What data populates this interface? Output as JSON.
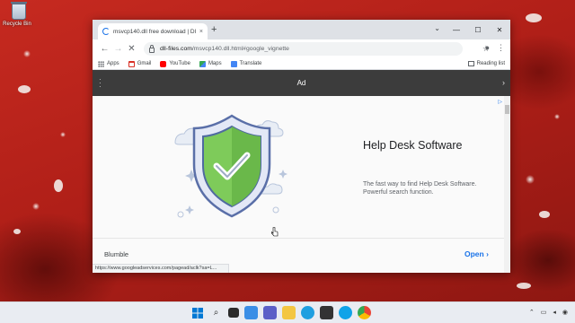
{
  "desktop": {
    "icon_label": "Recycle Bin"
  },
  "browser": {
    "tab_title": "msvcp140.dll free download | Dl",
    "tab_close": "×",
    "new_tab": "+",
    "window_controls": {
      "minimize": "—",
      "maximize": "☐",
      "close": "✕"
    },
    "url_host": "dll-files.com",
    "url_rest": "/msvcp140.dll.html#google_vignette",
    "bookmarks": [
      {
        "label": "Apps",
        "icon": "apps-icon"
      },
      {
        "label": "Gmail",
        "icon": "gmail-icon"
      },
      {
        "label": "YouTube",
        "icon": "youtube-icon"
      },
      {
        "label": "Maps",
        "icon": "maps-icon"
      },
      {
        "label": "Translate",
        "icon": "translate-icon"
      }
    ],
    "reading_list": "Reading list",
    "status_url": "https://www.googleadservices.com/pagead/aclk?sa=L..."
  },
  "ad": {
    "bar_title": "Ad",
    "heading": "Help Desk Software",
    "description": "The fast way to find Help Desk Software. Powerful search function.",
    "advertiser": "Blumble",
    "open_label": "Open",
    "colors": {
      "shield_green": "#7ecb5a",
      "shield_border": "#5a6fa8",
      "accent": "#1a73e8"
    }
  }
}
